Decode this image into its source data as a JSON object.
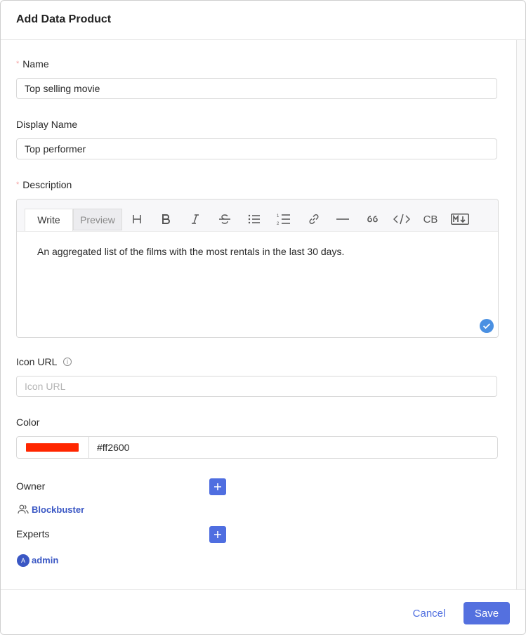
{
  "modal": {
    "title": "Add Data Product"
  },
  "fields": {
    "name": {
      "label": "Name",
      "value": "Top selling movie"
    },
    "display_name": {
      "label": "Display Name",
      "value": "Top performer"
    },
    "description": {
      "label": "Description",
      "tabs": [
        "Write",
        "Preview"
      ],
      "toolbar_icons": [
        "heading-icon",
        "bold-icon",
        "italic-icon",
        "strikethrough-icon",
        "bullet-list-icon",
        "numbered-list-icon",
        "link-icon",
        "horizontal-rule-icon",
        "quote-icon",
        "code-icon",
        "code-block-icon",
        "markdown-icon"
      ],
      "code_block_label": "CB",
      "value": "An aggregated list of the films with the most rentals in the last 30 days."
    },
    "icon_url": {
      "label": "Icon URL",
      "placeholder": "Icon URL",
      "value": ""
    },
    "color": {
      "label": "Color",
      "value": "#ff2600",
      "swatch": "#ff2600"
    },
    "owner": {
      "label": "Owner",
      "value": "Blockbuster"
    },
    "experts": {
      "label": "Experts",
      "value": "admin",
      "avatar_letter": "A"
    }
  },
  "footer": {
    "cancel_label": "Cancel",
    "save_label": "Save"
  },
  "colors": {
    "accent": "#4f6ee0",
    "required": "#f5a3a3",
    "check": "#4a90e2"
  }
}
